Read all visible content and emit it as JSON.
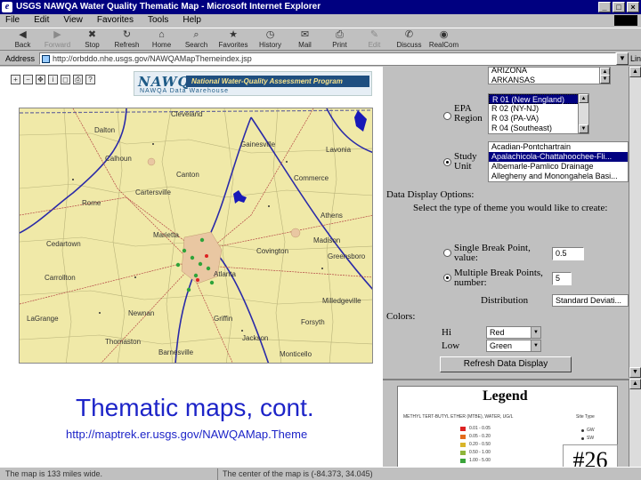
{
  "window": {
    "title": "USGS NAWQA Water Quality Thematic Map - Microsoft Internet Explorer",
    "controls": [
      "_",
      "□",
      "×"
    ]
  },
  "menu": [
    "File",
    "Edit",
    "View",
    "Favorites",
    "Tools",
    "Help"
  ],
  "toolbar": [
    {
      "label": "Back",
      "icon": "back-arrow-icon",
      "glyph": "◀",
      "disabled": false
    },
    {
      "label": "Forward",
      "icon": "forward-arrow-icon",
      "glyph": "▶",
      "disabled": true
    },
    {
      "label": "Stop",
      "icon": "stop-icon",
      "glyph": "✖",
      "disabled": false
    },
    {
      "label": "Refresh",
      "icon": "refresh-icon",
      "glyph": "↻",
      "disabled": false
    },
    {
      "label": "Home",
      "icon": "home-icon",
      "glyph": "⌂",
      "disabled": false
    },
    {
      "label": "Search",
      "icon": "search-icon",
      "glyph": "⌕",
      "disabled": false
    },
    {
      "label": "Favorites",
      "icon": "favorites-icon",
      "glyph": "★",
      "disabled": false
    },
    {
      "label": "History",
      "icon": "history-icon",
      "glyph": "◷",
      "disabled": false
    },
    {
      "label": "Mail",
      "icon": "mail-icon",
      "glyph": "✉",
      "disabled": false
    },
    {
      "label": "Print",
      "icon": "print-icon",
      "glyph": "⎙",
      "disabled": false
    },
    {
      "label": "Edit",
      "icon": "edit-icon",
      "glyph": "✎",
      "disabled": true
    },
    {
      "label": "Discuss",
      "icon": "discuss-icon",
      "glyph": "✆",
      "disabled": false
    },
    {
      "label": "RealCom",
      "icon": "realcom-icon",
      "glyph": "◉",
      "disabled": false
    }
  ],
  "address": {
    "label": "Address",
    "value": "http://orbddo.nhe.usgs.gov/NAWQAMapThemeindex.jsp",
    "links_label": "Links"
  },
  "banner": {
    "logo": "NAWQA",
    "tagline": "National Water-Quality Assessment Program",
    "subtitle": "NAWQA Data Warehouse"
  },
  "map_labels": [
    {
      "text": "Cleveland"
    },
    {
      "text": "Calhoun"
    },
    {
      "text": "Canton"
    },
    {
      "text": "Rome"
    },
    {
      "text": "Cedartown"
    },
    {
      "text": "Marietta"
    },
    {
      "text": "Atlanta"
    },
    {
      "text": "Athens"
    },
    {
      "text": "Newnan"
    },
    {
      "text": "Griffin"
    },
    {
      "text": "Gainesville"
    },
    {
      "text": "Commerce"
    },
    {
      "text": "Lavonia"
    },
    {
      "text": "Dalton"
    },
    {
      "text": "Covington"
    },
    {
      "text": "LaGrange"
    },
    {
      "text": "Thomaston"
    },
    {
      "text": "Monticello"
    },
    {
      "text": "Barnesville"
    },
    {
      "text": "Forsyth"
    },
    {
      "text": "Greensboro"
    },
    {
      "text": "Madison"
    },
    {
      "text": "Milledgeville"
    },
    {
      "text": "Jackson"
    },
    {
      "text": "Carrollton"
    },
    {
      "text": "Cartersville"
    }
  ],
  "slide": {
    "title": "Thematic maps, cont.",
    "url": "http://maptrek.er.usgs.gov/NAWQAMap.Theme",
    "number": "#26"
  },
  "form": {
    "states": [
      "ARIZONA",
      "ARKANSAS"
    ],
    "epa_label": "EPA Region",
    "epa_regions": [
      "R 01 (New England)",
      "R 02 (NY-NJ)",
      "R 03 (PA-VA)",
      "R 04 (Southeast)"
    ],
    "study_label": "Study Unit",
    "study_units": [
      "Acadian-Pontchartrain",
      "Apalachicola-Chattahoochee-Fli...",
      "Albemarle-Pamlico Drainage",
      "Allegheny and Monongahela Basi..."
    ],
    "display_title": "Data Display Options:",
    "display_prompt": "Select the type of theme you would like to create:",
    "single_label": "Single Break Point, value:",
    "single_value": "0.5",
    "multiple_label": "Multiple Break Points, number:",
    "multiple_value": "5",
    "distribution_label": "Distribution",
    "distribution_value": "Standard Deviati...",
    "colors_title": "Colors:",
    "hi_label": "Hi",
    "hi_value": "Red",
    "low_label": "Low",
    "low_value": "Green",
    "refresh_label": "Refresh Data Display"
  },
  "legend": {
    "title": "Legend",
    "header": "METHYL TERT-BUTYL ETHER (MTBE), WATER, UG/L",
    "site_type_label": "Site Type",
    "rows": [
      {
        "label": "0.01 - 0.05",
        "color": "#d22"
      },
      {
        "label": "0.05 - 0.20",
        "color": "#e36b1c"
      },
      {
        "label": "0.20 - 0.50",
        "color": "#d9b52a"
      },
      {
        "label": "0.50 - 1.00",
        "color": "#8fb63a"
      },
      {
        "label": "1.00 - 5.00",
        "color": "#3aa43a"
      }
    ],
    "sites": [
      {
        "label": "GW",
        "color": "#333"
      },
      {
        "label": "SW",
        "color": "#333"
      }
    ]
  },
  "status": {
    "left": "The map is 133 miles wide.",
    "right": "The center of the map is (-84.373, 34.045)"
  }
}
